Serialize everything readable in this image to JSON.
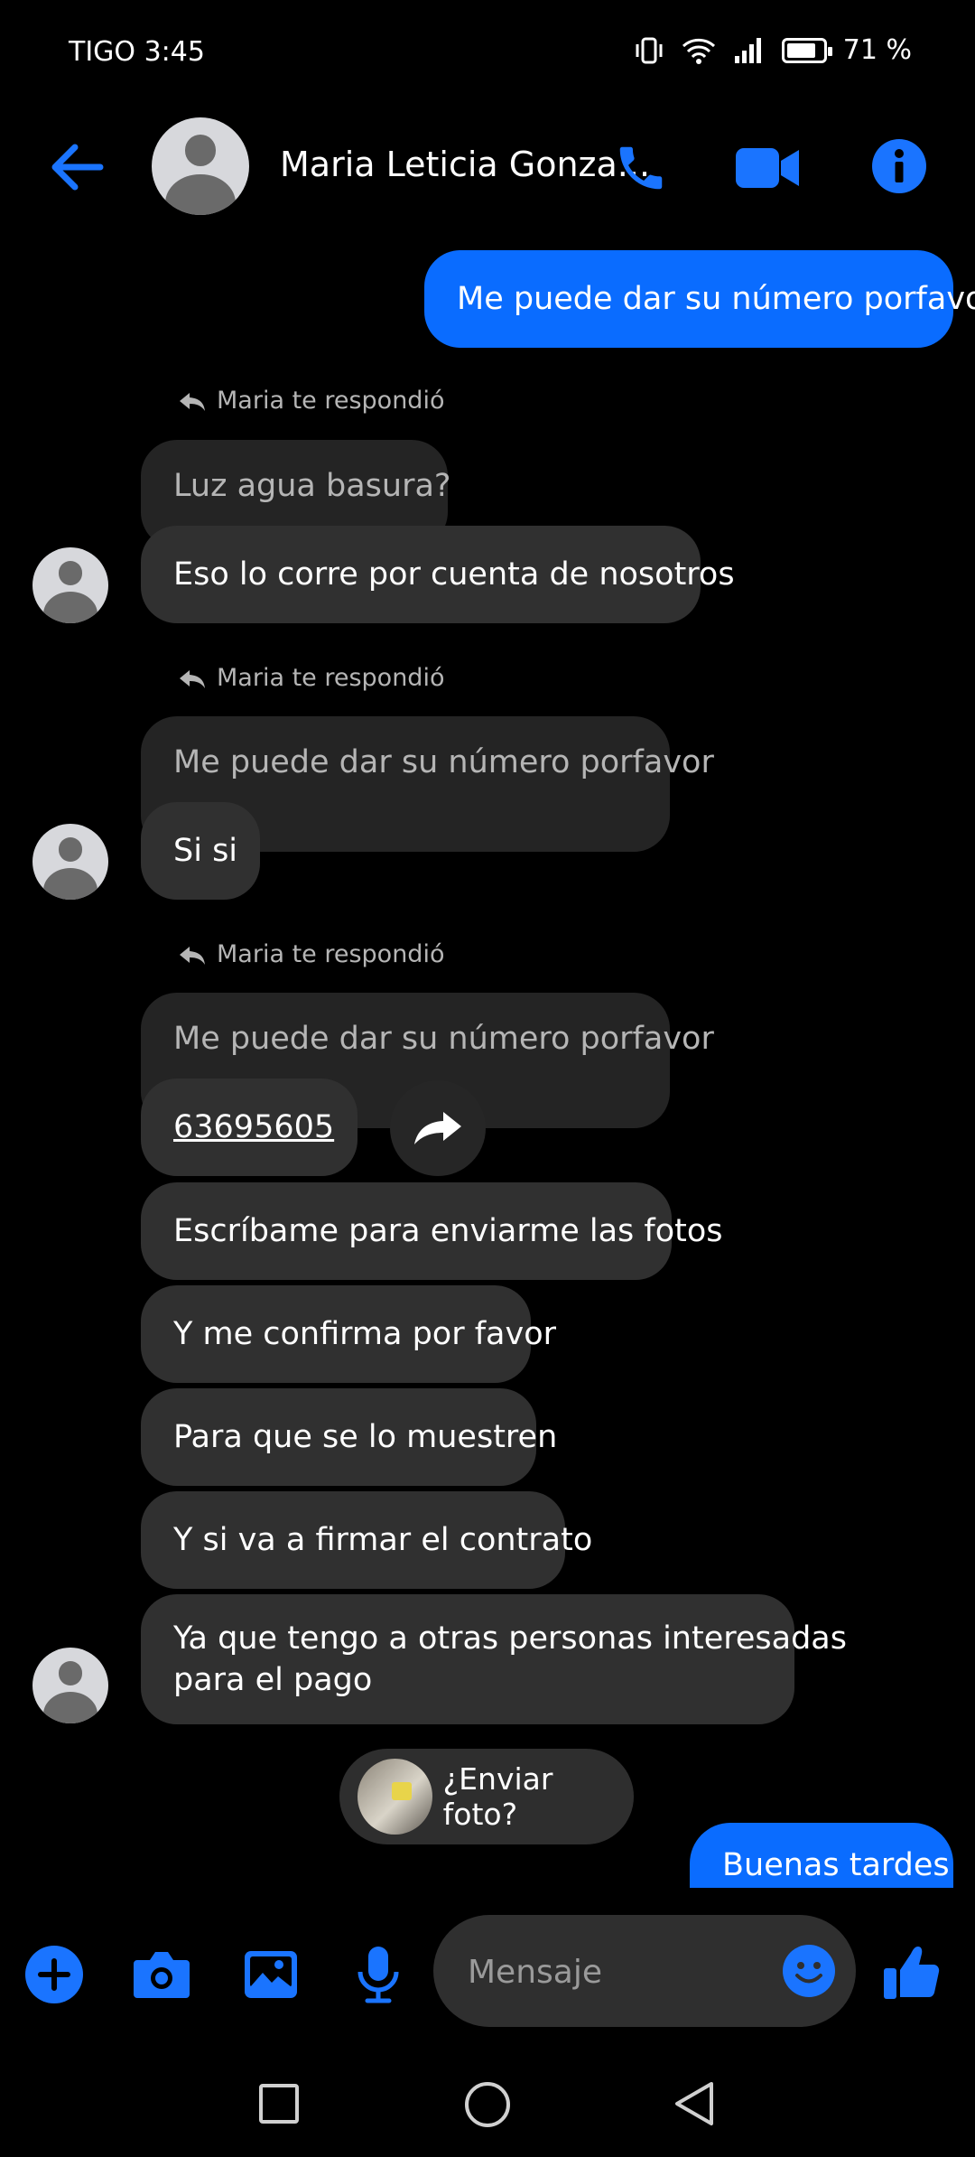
{
  "status_bar": {
    "carrier_time": "TIGO 3:45",
    "battery": "71 %"
  },
  "header": {
    "contact_name": "Maria Leticia Gonza..."
  },
  "messages": {
    "sent_1": "Me puede dar su número porfavor",
    "replied_label": "Maria te respondió",
    "quote_1": "Luz agua basura?",
    "reply_1": "Eso lo corre por cuenta de nosotros",
    "quote_2": "Me puede dar su número porfavor",
    "reply_2": "Si si",
    "quote_3": "Me puede dar su número porfavor",
    "reply_3": "63695605",
    "msg_4": "Escríbame para enviarme las fotos",
    "msg_5": "Y me confirma por favor",
    "msg_6": "Para que se lo muestren",
    "msg_7": "Y si va a firmar el contrato",
    "msg_8_line1": "Ya que tengo a otras personas interesadas",
    "msg_8_line2": "para el pago",
    "photo_prompt": "¿Enviar foto?",
    "sent_2": "Buenas tardes"
  },
  "composer": {
    "placeholder": "Mensaje"
  },
  "colors": {
    "accent": "#0a6cff",
    "incoming_bubble": "#303030",
    "background": "#000000"
  }
}
